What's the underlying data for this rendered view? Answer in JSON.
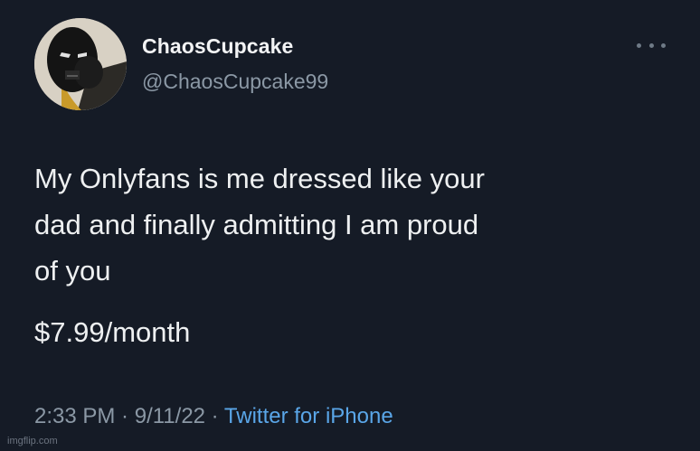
{
  "tweet": {
    "display_name": "ChaosCupcake",
    "handle": "@ChaosCupcake99",
    "more_icon": "more-horizontal-icon",
    "text": "My Onlyfans is me dressed like your\ndad and finally admitting I am proud\nof you",
    "price": "$7.99/month",
    "time": "2:33 PM",
    "separator": " · ",
    "date": "9/11/22",
    "source": "Twitter for iPhone"
  },
  "watermark": "imgflip.com",
  "colors": {
    "background": "#151b26",
    "text": "#eef0f1",
    "secondary": "#8b98a5",
    "link": "#5aa6e8"
  }
}
